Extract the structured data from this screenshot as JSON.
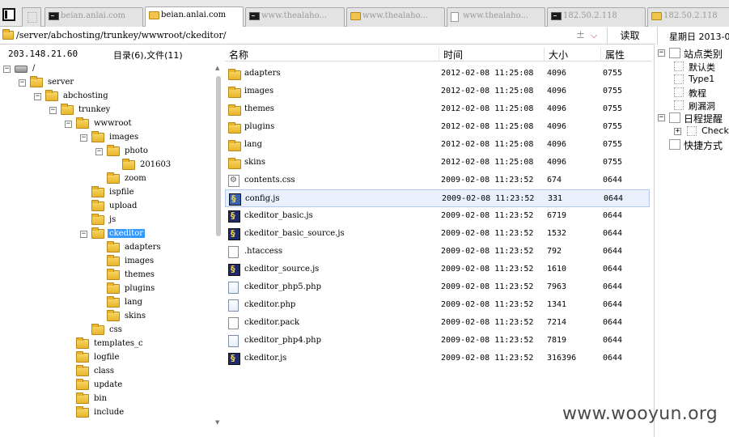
{
  "tabs": [
    {
      "label": "beian.anlai.com",
      "icon": "terminal-icon",
      "active": false
    },
    {
      "label": "beian.anlai.com",
      "icon": "folder-icon",
      "active": true
    },
    {
      "label": "www.thealaho...",
      "icon": "terminal-icon",
      "active": false
    },
    {
      "label": "www.thealaho...",
      "icon": "folder-icon",
      "active": false
    },
    {
      "label": "www.thealaho...",
      "icon": "page-icon",
      "active": false
    },
    {
      "label": "182.50.2.118",
      "icon": "terminal-icon",
      "active": false
    },
    {
      "label": "182.50.2.118",
      "icon": "folder-icon",
      "active": false
    }
  ],
  "address": {
    "path": "/server/abchosting/trunkey/wwwroot/ckeditor/",
    "plus": "±",
    "chevron": "⌵",
    "read_button": "读取"
  },
  "weekday": "星期日 2013-0",
  "info": {
    "ip": "203.148.21.60",
    "dir_summary": "目录(6),文件(11)"
  },
  "tree": [
    {
      "label": "/",
      "depth": 0,
      "exp": "-",
      "kind": "drive"
    },
    {
      "label": "server",
      "depth": 1,
      "exp": "-",
      "kind": "folder"
    },
    {
      "label": "abchosting",
      "depth": 2,
      "exp": "-",
      "kind": "folder"
    },
    {
      "label": "trunkey",
      "depth": 3,
      "exp": "-",
      "kind": "folder"
    },
    {
      "label": "wwwroot",
      "depth": 4,
      "exp": "-",
      "kind": "folder"
    },
    {
      "label": "images",
      "depth": 5,
      "exp": "-",
      "kind": "folder"
    },
    {
      "label": "photo",
      "depth": 6,
      "exp": "-",
      "kind": "folder"
    },
    {
      "label": "201603",
      "depth": 7,
      "exp": "",
      "kind": "folder"
    },
    {
      "label": "zoom",
      "depth": 6,
      "exp": "",
      "kind": "folder"
    },
    {
      "label": "ispfile",
      "depth": 5,
      "exp": "",
      "kind": "folder"
    },
    {
      "label": "upload",
      "depth": 5,
      "exp": "",
      "kind": "folder"
    },
    {
      "label": "js",
      "depth": 5,
      "exp": "",
      "kind": "folder"
    },
    {
      "label": "ckeditor",
      "depth": 5,
      "exp": "-",
      "kind": "folder",
      "selected": true
    },
    {
      "label": "adapters",
      "depth": 6,
      "exp": "",
      "kind": "folder"
    },
    {
      "label": "images",
      "depth": 6,
      "exp": "",
      "kind": "folder"
    },
    {
      "label": "themes",
      "depth": 6,
      "exp": "",
      "kind": "folder"
    },
    {
      "label": "plugins",
      "depth": 6,
      "exp": "",
      "kind": "folder"
    },
    {
      "label": "lang",
      "depth": 6,
      "exp": "",
      "kind": "folder"
    },
    {
      "label": "skins",
      "depth": 6,
      "exp": "",
      "kind": "folder"
    },
    {
      "label": "css",
      "depth": 5,
      "exp": "",
      "kind": "folder"
    },
    {
      "label": "templates_c",
      "depth": 4,
      "exp": "",
      "kind": "folder"
    },
    {
      "label": "logfile",
      "depth": 4,
      "exp": "",
      "kind": "folder"
    },
    {
      "label": "class",
      "depth": 4,
      "exp": "",
      "kind": "folder"
    },
    {
      "label": "update",
      "depth": 4,
      "exp": "",
      "kind": "folder"
    },
    {
      "label": "bin",
      "depth": 4,
      "exp": "",
      "kind": "folder"
    },
    {
      "label": "include",
      "depth": 4,
      "exp": "",
      "kind": "folder"
    }
  ],
  "columns": {
    "name": "名称",
    "time": "时间",
    "size": "大小",
    "attr": "属性"
  },
  "files": [
    {
      "name": "adapters",
      "time": "2012-02-08 11:25:08",
      "size": "4096",
      "attr": "0755",
      "icon": "folder-icon"
    },
    {
      "name": "images",
      "time": "2012-02-08 11:25:08",
      "size": "4096",
      "attr": "0755",
      "icon": "folder-icon"
    },
    {
      "name": "themes",
      "time": "2012-02-08 11:25:08",
      "size": "4096",
      "attr": "0755",
      "icon": "folder-icon"
    },
    {
      "name": "plugins",
      "time": "2012-02-08 11:25:08",
      "size": "4096",
      "attr": "0755",
      "icon": "folder-icon"
    },
    {
      "name": "lang",
      "time": "2012-02-08 11:25:08",
      "size": "4096",
      "attr": "0755",
      "icon": "folder-icon"
    },
    {
      "name": "skins",
      "time": "2012-02-08 11:25:08",
      "size": "4096",
      "attr": "0755",
      "icon": "folder-icon"
    },
    {
      "name": "contents.css",
      "time": "2009-02-08 11:23:52",
      "size": "674",
      "attr": "0644",
      "icon": "css-file-icon"
    },
    {
      "name": "config.js",
      "time": "2009-02-08 11:23:52",
      "size": "331",
      "attr": "0644",
      "icon": "js-file-icon",
      "selected": true
    },
    {
      "name": "ckeditor_basic.js",
      "time": "2009-02-08 11:23:52",
      "size": "6719",
      "attr": "0644",
      "icon": "js-file-icon"
    },
    {
      "name": "ckeditor_basic_source.js",
      "time": "2009-02-08 11:23:52",
      "size": "1532",
      "attr": "0644",
      "icon": "js-file-icon"
    },
    {
      "name": ".htaccess",
      "time": "2009-02-08 11:23:52",
      "size": "792",
      "attr": "0644",
      "icon": "blank-file-icon"
    },
    {
      "name": "ckeditor_source.js",
      "time": "2009-02-08 11:23:52",
      "size": "1610",
      "attr": "0644",
      "icon": "js-file-icon"
    },
    {
      "name": "ckeditor_php5.php",
      "time": "2009-02-08 11:23:52",
      "size": "7963",
      "attr": "0644",
      "icon": "php-file-icon"
    },
    {
      "name": "ckeditor.php",
      "time": "2009-02-08 11:23:52",
      "size": "1341",
      "attr": "0644",
      "icon": "php-file-icon"
    },
    {
      "name": "ckeditor.pack",
      "time": "2009-02-08 11:23:52",
      "size": "7214",
      "attr": "0644",
      "icon": "blank-file-icon"
    },
    {
      "name": "ckeditor_php4.php",
      "time": "2009-02-08 11:23:52",
      "size": "7819",
      "attr": "0644",
      "icon": "php-file-icon"
    },
    {
      "name": "ckeditor.js",
      "time": "2009-02-08 11:23:52",
      "size": "316396",
      "attr": "0644",
      "icon": "js-file-icon"
    }
  ],
  "right_panel": [
    {
      "label": "站点类别",
      "exp": "-",
      "child": false
    },
    {
      "label": "默认类",
      "exp": "",
      "child": true
    },
    {
      "label": "Type1",
      "exp": "",
      "child": true
    },
    {
      "label": "教程",
      "exp": "",
      "child": true
    },
    {
      "label": "刷漏洞",
      "exp": "",
      "child": true
    },
    {
      "label": "日程提醒",
      "exp": "-",
      "child": false
    },
    {
      "label": "Check",
      "exp": "+",
      "child": true
    },
    {
      "label": "快捷方式",
      "exp": "",
      "child": false
    }
  ],
  "watermark": "www.wooyun.org"
}
